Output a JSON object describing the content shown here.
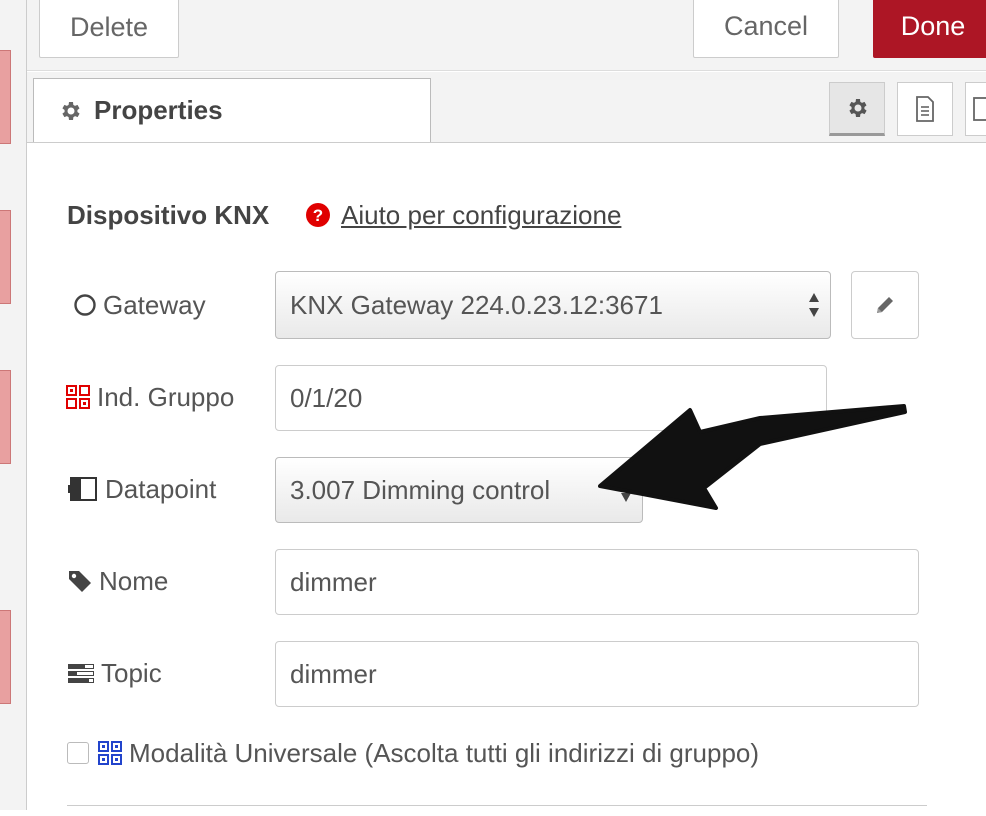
{
  "toolbar": {
    "delete_label": "Delete",
    "cancel_label": "Cancel",
    "done_label": "Done"
  },
  "tabs": {
    "properties_label": "Properties"
  },
  "section": {
    "title": "Dispositivo KNX",
    "help_link": "Aiuto per configurazione"
  },
  "form": {
    "gateway": {
      "label": "Gateway",
      "value": "KNX Gateway 224.0.23.12:3671"
    },
    "group": {
      "label": "Ind. Gruppo",
      "value": "0/1/20"
    },
    "datapoint": {
      "label": "Datapoint",
      "value": "3.007 Dimming control"
    },
    "name": {
      "label": "Nome",
      "value": "dimmer"
    },
    "topic": {
      "label": "Topic",
      "value": "dimmer"
    },
    "universal": {
      "label": "Modalità Universale (Ascolta tutti gli indirizzi di gruppo)",
      "checked": false
    }
  },
  "colors": {
    "done": "#ad1625",
    "help_icon": "#e00000",
    "group_icon": "#e00000",
    "universal_icon": "#2244cc"
  }
}
